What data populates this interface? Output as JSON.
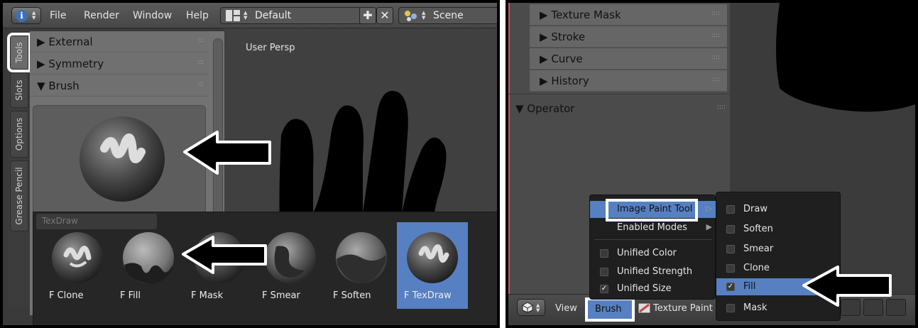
{
  "left_panel": {
    "menu": {
      "file": "File",
      "render": "Render",
      "window": "Window",
      "help": "Help"
    },
    "screen_layout": "Default",
    "scene": "Scene",
    "tabs": [
      "Tools",
      "Slots",
      "Options",
      "Grease Pencil"
    ],
    "sections": [
      {
        "label": "External",
        "state": "collapsed"
      },
      {
        "label": "Symmetry",
        "state": "collapsed"
      },
      {
        "label": "Brush",
        "state": "expanded"
      }
    ],
    "viewport_label": "User Persp",
    "popup_field_ghost": "TexDraw",
    "brushes": [
      {
        "name": "F Clone",
        "selected": false
      },
      {
        "name": "F Fill",
        "selected": false
      },
      {
        "name": "F Mask",
        "selected": false
      },
      {
        "name": "F Smear",
        "selected": false
      },
      {
        "name": "F Soften",
        "selected": false
      },
      {
        "name": "F TexDraw",
        "selected": true
      }
    ]
  },
  "right_panel": {
    "sections": [
      {
        "label": "Texture Mask"
      },
      {
        "label": "Stroke"
      },
      {
        "label": "Curve"
      },
      {
        "label": "History"
      }
    ],
    "operator_label": "Operator",
    "brush_menu": {
      "items": [
        {
          "label": "Image Paint Tool",
          "submenu": true,
          "highlighted": true
        },
        {
          "label": "Enabled Modes",
          "submenu": true
        },
        {
          "label": "Unified Color",
          "checked": false
        },
        {
          "label": "Unified Strength",
          "checked": false
        },
        {
          "label": "Unified Size",
          "checked": true
        }
      ]
    },
    "tool_submenu": {
      "items": [
        {
          "label": "Draw",
          "checked": false
        },
        {
          "label": "Soften",
          "checked": false
        },
        {
          "label": "Smear",
          "checked": false
        },
        {
          "label": "Clone",
          "checked": false
        },
        {
          "label": "Fill",
          "checked": true,
          "highlighted": true
        },
        {
          "label": "Mask",
          "checked": false
        }
      ]
    },
    "header": {
      "view": "View",
      "brush": "Brush",
      "mode": "Texture Paint"
    }
  },
  "colors": {
    "selection_blue": "#5680c2",
    "highlight_frame": "#ffffff",
    "arrow_fill": "#000000"
  },
  "icons": [
    "info-icon",
    "screen-layout-icon",
    "add-icon",
    "remove-icon",
    "scene-icon",
    "cube-icon",
    "texture-paint-icon",
    "right-arrow-pointer",
    "left-arrow-pointer"
  ]
}
